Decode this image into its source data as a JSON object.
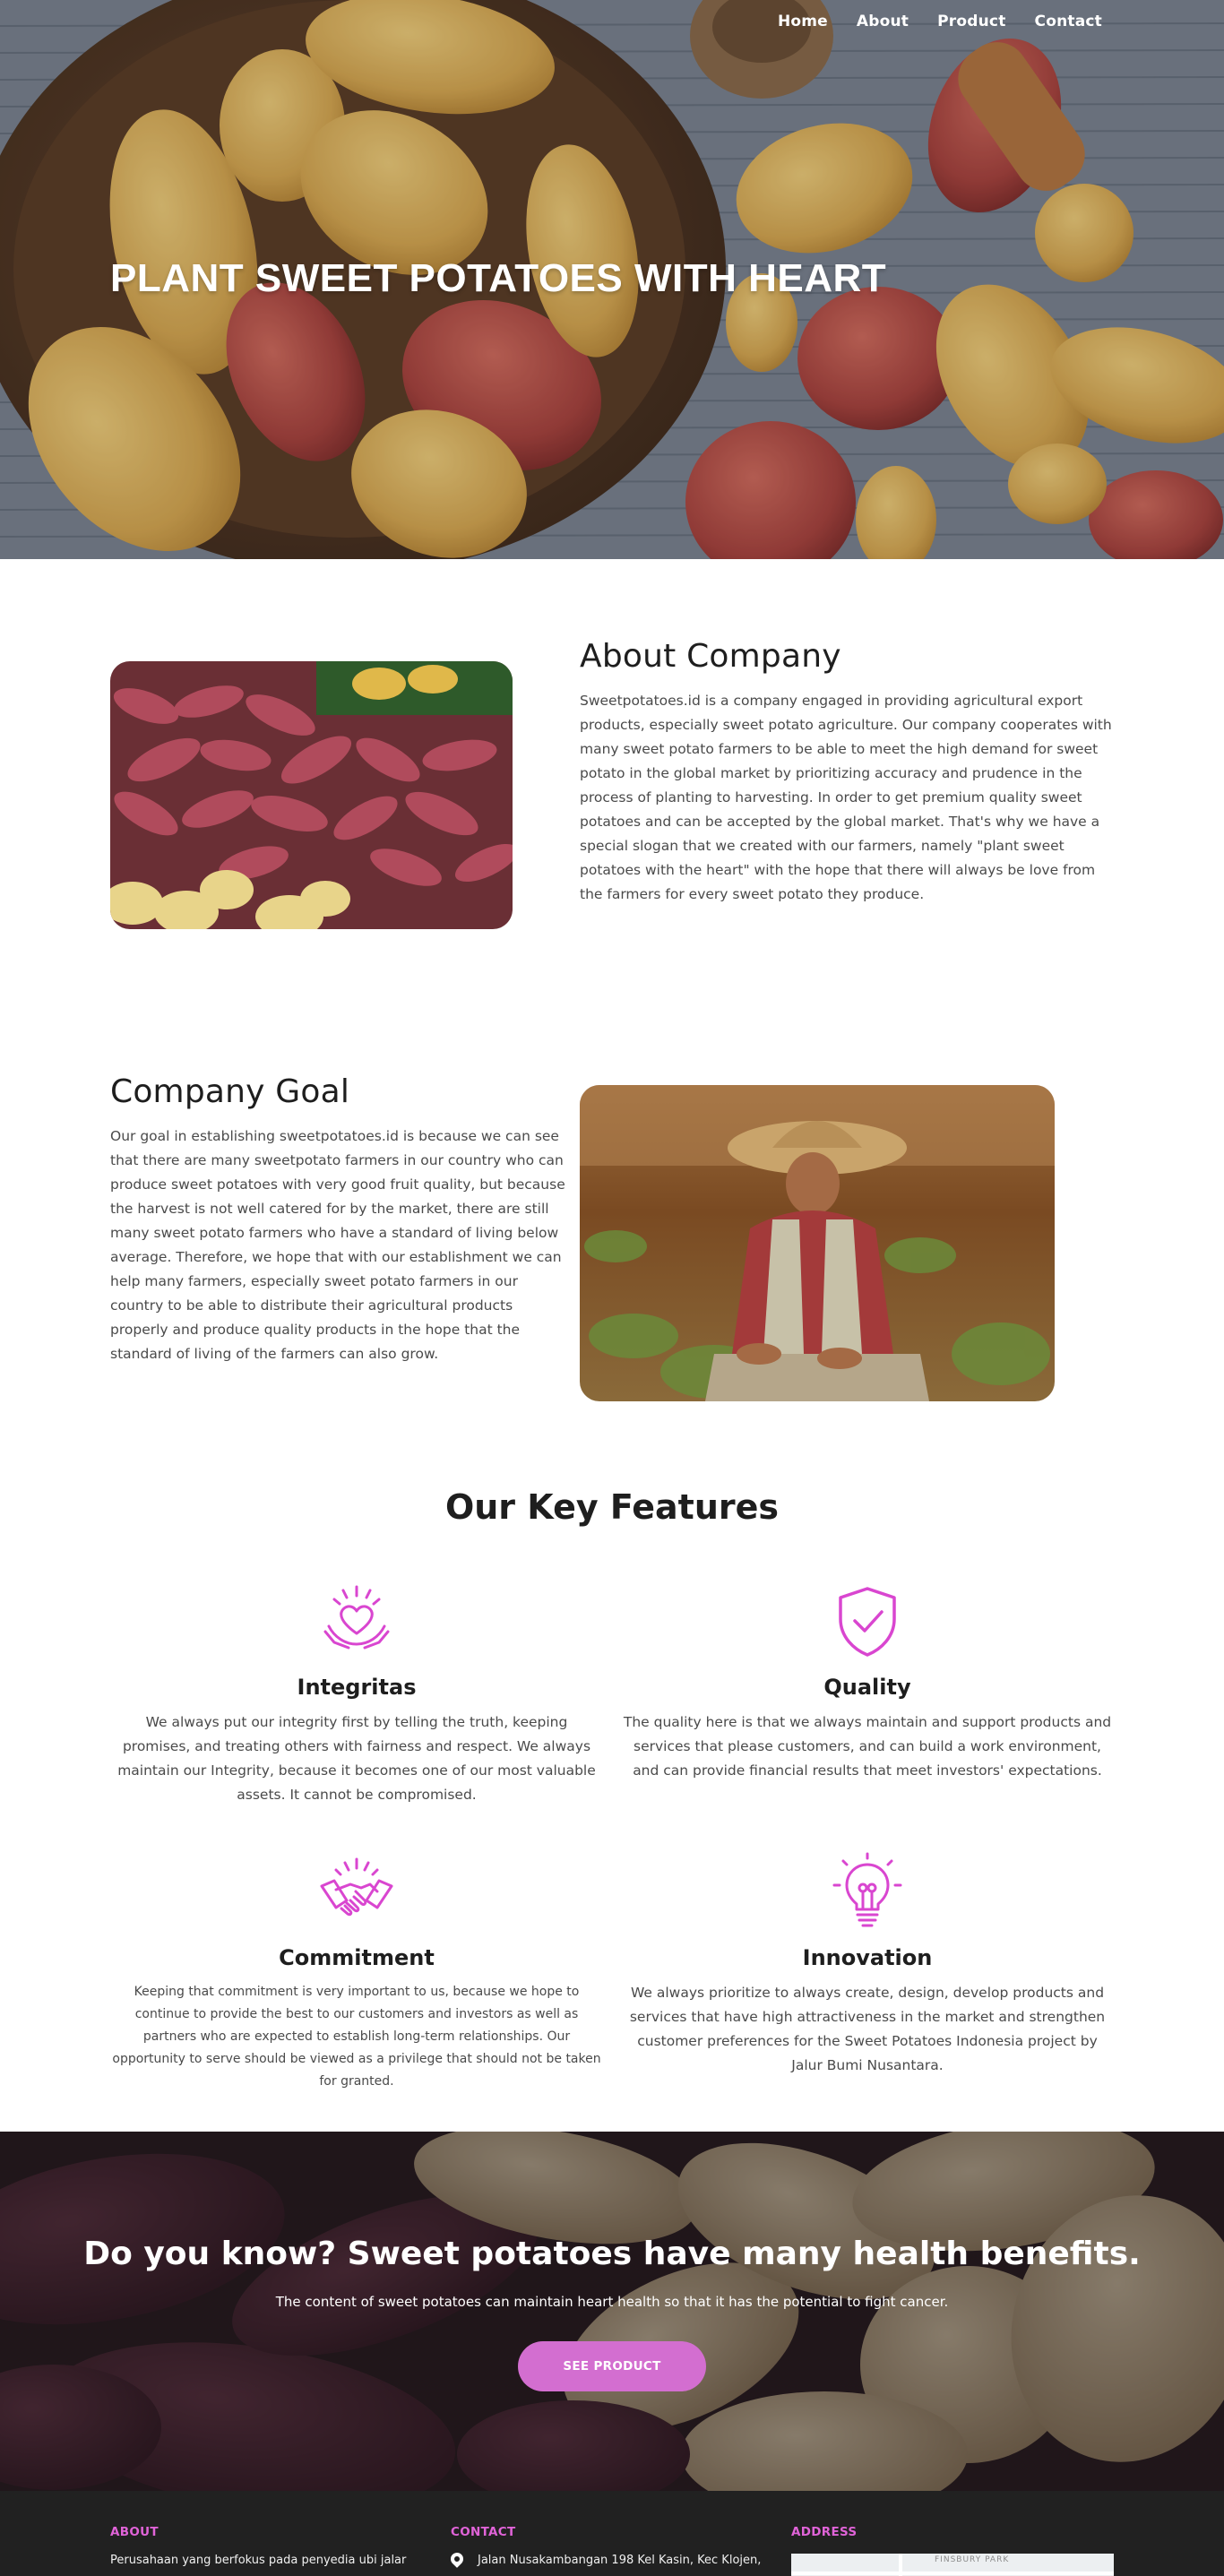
{
  "nav": {
    "items": [
      {
        "label": "Home"
      },
      {
        "label": "About"
      },
      {
        "label": "Product"
      },
      {
        "label": "Contact"
      }
    ]
  },
  "hero": {
    "title": "PLANT SWEET POTATOES WITH HEART"
  },
  "about": {
    "title": "About Company",
    "text": "Sweetpotatoes.id is a company engaged in providing agricultural export products, especially sweet potato agriculture. Our company cooperates with many sweet potato farmers to be able to meet the high demand for sweet potato in the global market by prioritizing accuracy and prudence in the process of planting to harvesting. In order to get premium quality sweet potatoes and can be accepted by the global market. That's why we have a special slogan that we created with our farmers, namely \"plant sweet potatoes with the heart\" with the hope that there will always be love from the farmers for every sweet potato they produce."
  },
  "goal": {
    "title": "Company Goal",
    "text": "Our goal in establishing sweetpotatoes.id is because we can see that there are many sweetpotato farmers in our country who can produce sweet potatoes with very good fruit quality, but because the harvest is not well catered for by the market, there are still many sweet potato farmers who have a standard of living below average. Therefore, we hope that with our establishment we can help many farmers, especially sweet potato farmers in our country to be able to distribute their agricultural products properly and produce quality products in the hope that the standard of living of the farmers can also grow."
  },
  "features": {
    "title_prefix": "Our",
    "title_bold": "Key Features",
    "items": [
      {
        "title": "Integritas",
        "icon": "heart-hands-icon",
        "text": "We always put our integrity first by telling the truth, keeping promises, and treating others with fairness and respect. We always maintain our Integrity, because it becomes one of our most valuable assets. It cannot be compromised."
      },
      {
        "title": "Quality",
        "icon": "shield-check-icon",
        "text": "The quality here is that we always maintain and support products and services that please customers, and can build a work environment, and can provide financial results that meet investors' expectations."
      },
      {
        "title": "Commitment",
        "icon": "handshake-icon",
        "text": "Keeping that commitment is very important to us, because we hope to continue to provide the best to our customers and investors as well as partners who are expected to establish long-term relationships. Our opportunity to serve should be viewed as a privilege that should not be taken for granted."
      },
      {
        "title": "Innovation",
        "icon": "lightbulb-icon",
        "text": "We always prioritize to always create, design, develop products and services that have high attractiveness in the market and strengthen customer preferences for the Sweet Potatoes Indonesia project by Jalur Bumi Nusantara."
      }
    ],
    "accent": "#d946d0"
  },
  "cta": {
    "title": "Do you know? Sweet potatoes have many health benefits.",
    "text": "The content of sweet potatoes can maintain heart health so that it has the potential to fight cancer.",
    "button": "SEE PRODUCT",
    "button_color": "#d36ed0"
  },
  "footer": {
    "about_heading": "ABOUT",
    "about_text": "Perusahaan yang berfokus pada penyedia ubi jalar",
    "contact_heading": "CONTACT",
    "contact_address": "Jalan Nusakambangan 198 Kel Kasin, Kec Klojen,",
    "address_heading": "ADDRESS",
    "map_label": "FINSBURY PARK",
    "heading_color": "#e063d8"
  }
}
